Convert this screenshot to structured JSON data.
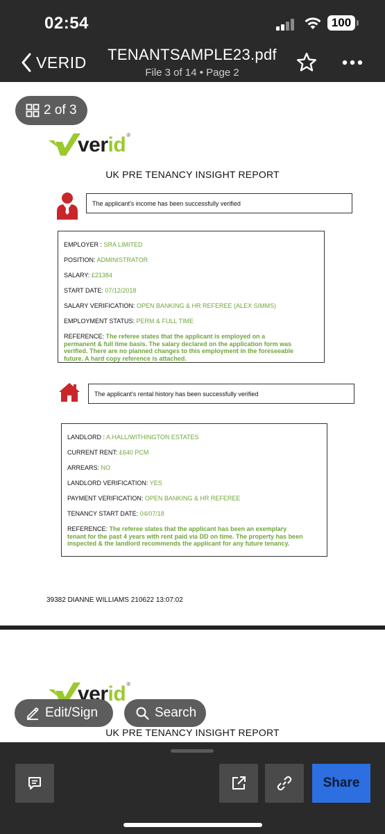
{
  "status_bar": {
    "time": "02:54",
    "battery": "100"
  },
  "nav": {
    "back_label": "VERID",
    "title": "TENANTSAMPLE23.pdf",
    "subtitle": "File 3 of 14 • Page 2"
  },
  "page_indicator": "2 of 3",
  "logo": {
    "text_main": "ver",
    "text_accent": "id",
    "reg": "®"
  },
  "report_title": "UK PRE TENANCY INSIGHT REPORT",
  "income": {
    "notice": "The applicant's income has been successfully verified",
    "fields": [
      {
        "label": "EMPLOYER : ",
        "value": "SRA LIMITED"
      },
      {
        "label": "POSITION: ",
        "value": "ADMINISTRATOR"
      },
      {
        "label": "SALARY: ",
        "value": "£21384"
      },
      {
        "label": "START DATE: ",
        "value": "07/12/2018"
      },
      {
        "label": "SALARY VERIFICATION: ",
        "value": "OPEN BANKING & HR REFEREE (ALEX SIMMS)"
      },
      {
        "label": "EMPLOYMENT STATUS: ",
        "value": "PERM & FULL TIME"
      }
    ],
    "reference_label": "REFERENCE: ",
    "reference_text": "The referee states that the applicant is employed on a permanent & full time basis. The salary declared on the application form was verified. There are no planned changes to this employment in the foreseeable future. A hard copy reference is attached."
  },
  "rental": {
    "notice": "The applicant's rental history has been successfully verified",
    "fields": [
      {
        "label": "LANDLORD : ",
        "value": "A.HALL/WITHINGTON ESTATES"
      },
      {
        "label": "CURRENT RENT: ",
        "value": "£640 PCM"
      },
      {
        "label": "ARREARS: ",
        "value": "NO"
      },
      {
        "label": "LANDLORD VERIFICATION: ",
        "value": "YES"
      },
      {
        "label": "PAYMENT VERIFICATION: ",
        "value": "OPEN BANKING & HR REFEREE"
      },
      {
        "label": "TENANCY START DATE: ",
        "value": "04/07/18"
      }
    ],
    "reference_label": "REFERENCE: ",
    "reference_text": "The referee states that the applicant has been an exemplary tenant for the past 4 years with rent paid via DD on time. The property has been inspected & the landlord recommends the applicant for any future tenancy."
  },
  "footer_id": "39382 DIANNE WILLIAMS 210622 13:07:02",
  "page3": {
    "report_title": "UK PRE TENANCY INSIGHT REPORT"
  },
  "actions": {
    "edit_sign": "Edit/Sign",
    "search": "Search",
    "share": "Share"
  },
  "colors": {
    "accent_green": "#9ac92e",
    "value_green": "#6fa63a",
    "icon_red": "#c8262b",
    "share_blue": "#2d6fe0",
    "bar_dark": "#2a2a2a"
  },
  "icons": [
    "back-chevron-icon",
    "star-icon",
    "more-icon",
    "grid-icon",
    "person-icon",
    "house-icon",
    "pen-icon",
    "search-icon",
    "comment-icon",
    "open-external-icon",
    "link-icon"
  ]
}
